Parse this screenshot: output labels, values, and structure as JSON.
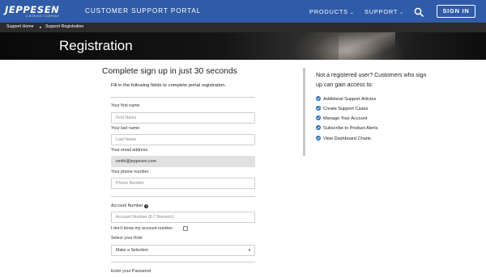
{
  "header": {
    "logo_text": "JEPPESEN",
    "logo_sub": "A BOEING COMPANY",
    "portal_title": "CUSTOMER SUPPORT PORTAL",
    "nav_products": "PRODUCTS",
    "nav_support": "SUPPORT",
    "signin_label": "SIGN IN",
    "brand_color": "#2f5ba8"
  },
  "breadcrumb": {
    "home": "Support Home",
    "separator": "▸",
    "current": "Support Registration"
  },
  "hero": {
    "title": "Registration"
  },
  "form": {
    "heading": "Complete sign up in just 30 seconds",
    "intro": "Fill in the following fields to complete portal registration.",
    "first_name_label": "Your first name",
    "first_name_placeholder": "First Name",
    "last_name_label": "Your last name",
    "last_name_placeholder": "Last Name",
    "email_label": "Your email address",
    "email_value": "smith@jeppesen.com",
    "phone_label": "Your phone number",
    "phone_placeholder": "Phone Number",
    "account_label": "Account Number",
    "account_info_icon": "i",
    "account_placeholder": "Account Number (6-7 Numeric)",
    "no_account_label": "I don't know my account number",
    "role_label": "Select your Role",
    "role_selected": "Make a Selection",
    "password_label": "Enter your Password"
  },
  "sidebar": {
    "promo": "Not a registered user? Customers who sign up can gain access to:",
    "benefits": [
      "Additional Support Articles",
      "Create Support Cases",
      "Manage Your Account",
      "Subscribe to Product Alerts",
      "View Dashboard Charts"
    ],
    "check_color": "#2a6fb8"
  },
  "icons": {
    "search": "search-icon",
    "chevron": "chevron-down-icon",
    "check": "check-circle-icon",
    "info": "info-icon"
  }
}
